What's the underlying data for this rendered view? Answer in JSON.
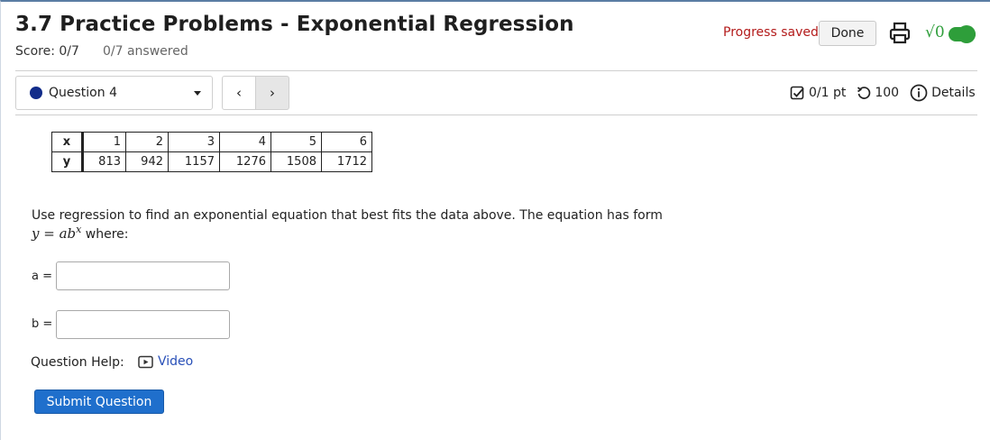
{
  "header": {
    "title": "3.7 Practice Problems - Exponential Regression",
    "score": "Score: 0/7",
    "answered": "0/7 answered",
    "progress_saved": "Progress saved",
    "done_label": "Done",
    "sqrt_glyph": "√0",
    "icons": [
      "print-icon",
      "sqrt-icon",
      "toggle-switch"
    ]
  },
  "nav": {
    "question_label": "Question 4",
    "prev_glyph": "‹",
    "next_glyph": "›",
    "points": "0/1 pt",
    "retries": "100",
    "details": "Details",
    "icons": [
      "checkbox-icon",
      "retry-icon",
      "info-icon",
      "chevron-down-icon"
    ]
  },
  "table": {
    "x_label": "x",
    "y_label": "y",
    "x_values": [
      "1",
      "2",
      "3",
      "4",
      "5",
      "6"
    ],
    "y_values": [
      "813",
      "942",
      "1157",
      "1276",
      "1508",
      "1712"
    ]
  },
  "question": {
    "prompt": "Use regression to find an exponential equation that best fits the data above. The equation has form",
    "formula": "y = ab",
    "formula_exp": "x",
    "formula_rest": " where:",
    "a_label": "a =",
    "b_label": "b =",
    "a_value": "",
    "b_value": ""
  },
  "help": {
    "label": "Question Help:",
    "video": "Video",
    "icon": "video-icon"
  },
  "submit_label": "Submit Question",
  "colors": {
    "accent": "#1f6fcc",
    "saved_red": "#b31b1b",
    "toggle_green": "#2e9e3a",
    "question_dot": "#122c8a",
    "link_blue": "#2950b8"
  }
}
